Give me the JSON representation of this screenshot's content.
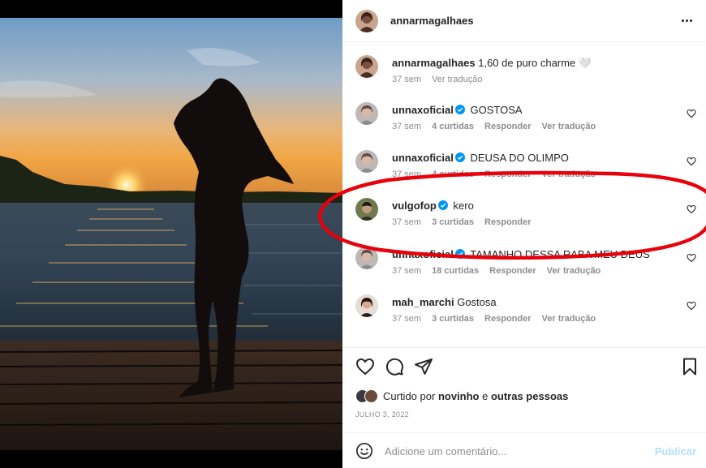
{
  "post": {
    "username": "annarmagalhaes",
    "caption": "1,60 de puro charme 🤍",
    "caption_time": "37 sem",
    "caption_translate": "Ver tradução"
  },
  "comments": [
    {
      "user": "unnaxoficial",
      "verified": true,
      "text": "GOSTOSA",
      "time": "37 sem",
      "likes": "4 curtidas",
      "reply": "Responder",
      "translate": "Ver tradução"
    },
    {
      "user": "unnaxoficial",
      "verified": true,
      "text": "DEUSA DO OLIMPO",
      "time": "37 sem",
      "likes": "4 curtidas",
      "reply": "Responder",
      "translate": "Ver tradução"
    },
    {
      "user": "vulgofop",
      "verified": true,
      "text": "kero",
      "time": "37 sem",
      "likes": "3 curtidas",
      "reply": "Responder",
      "translate": ""
    },
    {
      "user": "unnaxoficial",
      "verified": true,
      "text": "TAMANHO DESSA RABA MEU DEUS",
      "time": "37 sem",
      "likes": "18 curtidas",
      "reply": "Responder",
      "translate": "Ver tradução"
    },
    {
      "user": "mah_marchi",
      "verified": false,
      "text": "Gostosa",
      "time": "37 sem",
      "likes": "3 curtidas",
      "reply": "Responder",
      "translate": "Ver tradução"
    }
  ],
  "likes": {
    "prefix": "Curtido por",
    "first_user": "novinho",
    "conj": "e",
    "others": "outras pessoas"
  },
  "date": "JULHO 3, 2022",
  "comment_bar": {
    "placeholder": "Adicione um comentário...",
    "post_label": "Publicar"
  },
  "icons": {
    "more": "more-horizontal-icon",
    "like": "heart-icon",
    "comment": "comment-bubble-icon",
    "share": "paper-plane-icon",
    "save": "bookmark-icon",
    "emoji": "smiley-icon",
    "verified": "verified-badge-icon"
  },
  "colors": {
    "verified_blue": "#0095f6",
    "annotation_red": "#e8000b",
    "muted_text": "#8e8e8e",
    "post_disabled": "#b2dffc"
  }
}
